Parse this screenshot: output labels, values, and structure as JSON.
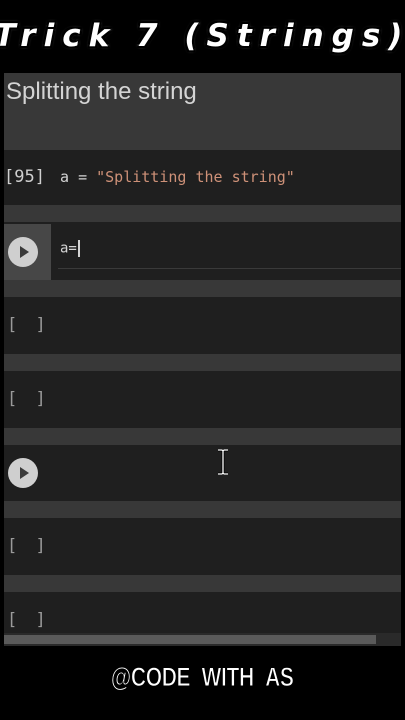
{
  "banner": {
    "title": "Trick 7 (Strings)"
  },
  "notebook": {
    "text_cell": {
      "heading": "Splitting the string"
    },
    "code_cell_1": {
      "exec_count": "[95]",
      "code_var": "a",
      "code_op": "=",
      "code_str": "\"Splitting the string\""
    },
    "active_cell": {
      "code": "a="
    },
    "empty_prompt": "[ ]",
    "icons": {
      "run": "play-circle-icon"
    }
  },
  "watermark": {
    "text": "@CODE_WITH_AS"
  },
  "colors": {
    "background": "#000000",
    "cell_light": "#383838",
    "cell_dark": "#1f1f1f",
    "string_literal": "#ce9178"
  }
}
